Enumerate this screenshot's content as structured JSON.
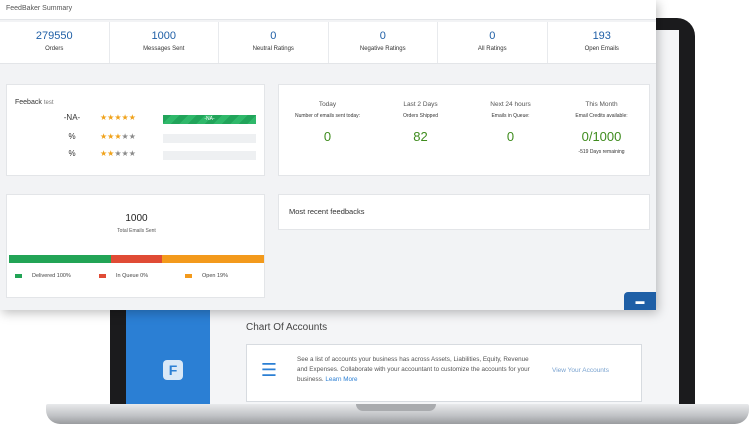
{
  "background_app": {
    "section_title": "Chart Of Accounts",
    "logo_letter": "F",
    "card": {
      "description": "See a list of accounts your business has across Assets, Liabilities, Equity, Revenue and Expenses. Collaborate with your accountant to customize the accounts for your business.",
      "learn_more": "Learn More",
      "link": "View Your Accounts"
    }
  },
  "dashboard": {
    "title": "FeedBaker Summary",
    "stats": [
      {
        "value": "279550",
        "label": "Orders"
      },
      {
        "value": "1000",
        "label": "Messages Sent"
      },
      {
        "value": "0",
        "label": "Neutral Ratings"
      },
      {
        "value": "0",
        "label": "Negative Ratings"
      },
      {
        "value": "0",
        "label": "All Ratings"
      },
      {
        "value": "193",
        "label": "Open Emails"
      }
    ],
    "feedback": {
      "title": "Feeback",
      "subtitle": "test",
      "rows": [
        {
          "label": "-NA-",
          "stars": "★★★★★",
          "rating": 5,
          "bar_text": "-NA-",
          "fill": 1.0
        },
        {
          "label": "%",
          "stars_on": "★★★",
          "stars_off": "★★",
          "rating": 3,
          "fill": 0
        },
        {
          "label": "%",
          "stars_on": "★★",
          "stars_off": "★★★",
          "rating": 2,
          "fill": 0
        }
      ]
    },
    "periods": [
      {
        "title": "Today",
        "sub": "Number of emails sent today:",
        "value": "0",
        "note": ""
      },
      {
        "title": "Last 2 Days",
        "sub": "Orders Shipped",
        "value": "82",
        "note": ""
      },
      {
        "title": "Next 24 hours",
        "sub": "Emails in Queue:",
        "value": "0",
        "note": ""
      },
      {
        "title": "This Month",
        "sub": "Email Credits available:",
        "value": "0/1000",
        "note": "-519 Days remaining"
      }
    ],
    "emails": {
      "count": "1000",
      "label": "Total Emails Sent",
      "segments": [
        {
          "name": "delivered",
          "percent": 40,
          "color": "#22a456"
        },
        {
          "name": "queue",
          "percent": 20,
          "color": "#e04b35"
        },
        {
          "name": "open",
          "percent": 40,
          "color": "#f39a1c"
        }
      ],
      "legend": [
        {
          "text": "Delivered 100%",
          "color": "#22a456"
        },
        {
          "text": "In Queue 0%",
          "color": "#e04b35"
        },
        {
          "text": "Open 19%",
          "color": "#f39a1c"
        }
      ]
    },
    "recent": {
      "title": "Most recent feedbacks"
    },
    "chat_icon": "chat-bubbles-icon"
  }
}
